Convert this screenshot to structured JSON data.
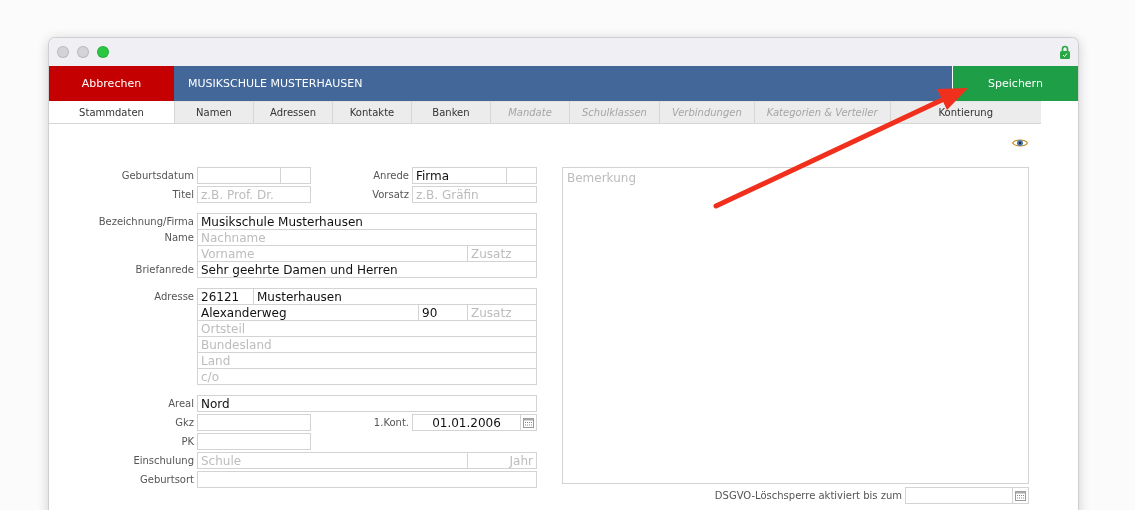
{
  "header": {
    "cancel": "Abbrechen",
    "title": "MUSIKSCHULE MUSTERHAUSEN",
    "save": "Speichern"
  },
  "tabs": [
    {
      "label": "Stammdaten",
      "selected": true,
      "disabled": false
    },
    {
      "label": "Namen",
      "selected": false,
      "disabled": false
    },
    {
      "label": "Adressen",
      "selected": false,
      "disabled": false
    },
    {
      "label": "Kontakte",
      "selected": false,
      "disabled": false
    },
    {
      "label": "Banken",
      "selected": false,
      "disabled": false
    },
    {
      "label": "Mandate",
      "selected": false,
      "disabled": true
    },
    {
      "label": "Schulklassen",
      "selected": false,
      "disabled": true
    },
    {
      "label": "Verbindungen",
      "selected": false,
      "disabled": true
    },
    {
      "label": "Kategorien & Verteiler",
      "selected": false,
      "disabled": true
    },
    {
      "label": "Kontierung",
      "selected": false,
      "disabled": false
    }
  ],
  "sections": [
    {
      "joined": false,
      "rows": [
        {
          "kind": "split",
          "label": "Geburtsdatum",
          "fields": [
            {
              "kind": "text"
            },
            {
              "kind": "small"
            }
          ],
          "side": {
            "label": "Anrede",
            "fields": [
              {
                "kind": "text",
                "value": "Firma"
              },
              {
                "kind": "small"
              }
            ]
          }
        },
        {
          "kind": "split",
          "label": "Titel",
          "fields": [
            {
              "kind": "text",
              "placeholder": "z.B. Prof. Dr."
            }
          ],
          "side": {
            "label": "Vorsatz",
            "fields": [
              {
                "kind": "text",
                "placeholder": "z.B. Gräfin"
              }
            ]
          }
        }
      ]
    },
    {
      "joined": true,
      "rows": [
        {
          "kind": "full",
          "label": "Bezeichnung/Firma",
          "fields": [
            {
              "kind": "text",
              "value": "Musikschule Musterhausen"
            }
          ]
        },
        {
          "kind": "full",
          "label": "Name",
          "fields": [
            {
              "kind": "text",
              "placeholder": "Nachname"
            }
          ]
        },
        {
          "kind": "full",
          "fields": [
            {
              "kind": "text",
              "placeholder": "Vorname"
            },
            {
              "kind": "suffix",
              "placeholder": "Zusatz"
            }
          ]
        },
        {
          "kind": "full",
          "label": "Briefanrede",
          "fields": [
            {
              "kind": "text",
              "value": "Sehr geehrte Damen und Herren"
            }
          ]
        }
      ]
    },
    {
      "joined": true,
      "rows": [
        {
          "kind": "full",
          "label": "Adresse",
          "fields": [
            {
              "kind": "zip",
              "value": "26121"
            },
            {
              "kind": "text",
              "value": "Musterhausen"
            }
          ]
        },
        {
          "kind": "full",
          "fields": [
            {
              "kind": "text",
              "value": "Alexanderweg"
            },
            {
              "kind": "number",
              "value": "90"
            },
            {
              "kind": "suffix",
              "placeholder": "Zusatz"
            }
          ]
        },
        {
          "kind": "full",
          "fields": [
            {
              "kind": "text",
              "placeholder": "Ortsteil"
            }
          ]
        },
        {
          "kind": "full",
          "fields": [
            {
              "kind": "text",
              "placeholder": "Bundesland"
            }
          ]
        },
        {
          "kind": "full",
          "fields": [
            {
              "kind": "text",
              "placeholder": "Land"
            }
          ]
        },
        {
          "kind": "full",
          "fields": [
            {
              "kind": "text",
              "placeholder": "c/o"
            }
          ]
        }
      ]
    },
    {
      "joined": false,
      "rows": [
        {
          "kind": "full",
          "label": "Areal",
          "fields": [
            {
              "kind": "text",
              "value": "Nord"
            }
          ]
        },
        {
          "kind": "split",
          "label": "Gkz",
          "fields": [
            {
              "kind": "text"
            }
          ],
          "side": {
            "label": "1.Kont.",
            "fields": [
              {
                "kind": "date",
                "value": "01.01.2006"
              }
            ]
          }
        },
        {
          "kind": "short",
          "label": "PK",
          "fields": [
            {
              "kind": "text"
            }
          ]
        },
        {
          "kind": "full",
          "label": "Einschulung",
          "fields": [
            {
              "kind": "text",
              "placeholder": "Schule"
            },
            {
              "kind": "year",
              "placeholder": "Jahr"
            }
          ]
        },
        {
          "kind": "full",
          "label": "Geburtsort",
          "fields": [
            {
              "kind": "text"
            }
          ]
        }
      ]
    }
  ],
  "notes": {
    "placeholder": "Bemerkung"
  },
  "gdpr": {
    "label": "DSGVO-Löschsperre aktiviert bis zum",
    "field": {
      "kind": "date"
    }
  }
}
